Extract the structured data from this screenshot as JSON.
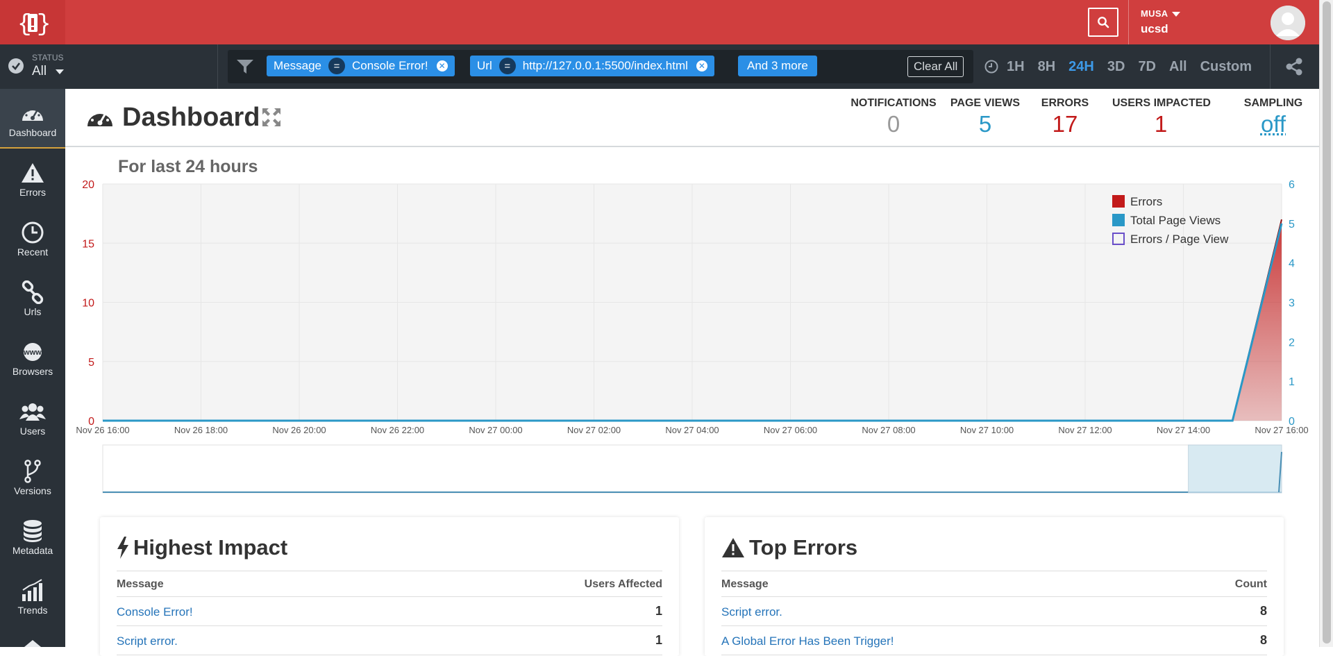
{
  "header": {
    "org_name": "MUSA",
    "user_name": "ucsd",
    "brand_color": "#d03e3e"
  },
  "filterbar": {
    "status_label": "STATUS",
    "status_value": "All",
    "chips": [
      {
        "field": "Message",
        "op": "=",
        "value": "Console Error!"
      },
      {
        "field": "Url",
        "op": "=",
        "value": "http://127.0.0.1:5500/index.html"
      }
    ],
    "more_label": "And 3 more",
    "clear_all_label": "Clear All",
    "time_options": [
      "1H",
      "8H",
      "24H",
      "3D",
      "7D",
      "All",
      "Custom"
    ],
    "active_time": "24H"
  },
  "sidebar": {
    "items": [
      {
        "label": "Dashboard",
        "icon": "dashboard-icon"
      },
      {
        "label": "Errors",
        "icon": "warning-icon"
      },
      {
        "label": "Recent",
        "icon": "clock-icon"
      },
      {
        "label": "Urls",
        "icon": "link-icon"
      },
      {
        "label": "Browsers",
        "icon": "www-icon"
      },
      {
        "label": "Users",
        "icon": "users-icon"
      },
      {
        "label": "Versions",
        "icon": "branch-icon"
      },
      {
        "label": "Metadata",
        "icon": "database-icon"
      },
      {
        "label": "Trends",
        "icon": "trends-icon"
      }
    ]
  },
  "page": {
    "title": "Dashboard",
    "stats": [
      {
        "label": "NOTIFICATIONS",
        "value": "0",
        "color": "#999999"
      },
      {
        "label": "PAGE VIEWS",
        "value": "5",
        "color": "#2a98c7"
      },
      {
        "label": "ERRORS",
        "value": "17",
        "color": "#c21a1a"
      },
      {
        "label": "USERS IMPACTED",
        "value": "1",
        "color": "#c21a1a"
      },
      {
        "label": "SAMPLING",
        "value": "off",
        "color": "#2a98c7"
      }
    ],
    "chart_heading": "For last 24 hours"
  },
  "chart_data": {
    "type": "area",
    "x": [
      "Nov 26 16:00",
      "Nov 26 18:00",
      "Nov 26 20:00",
      "Nov 26 22:00",
      "Nov 27 00:00",
      "Nov 27 02:00",
      "Nov 27 04:00",
      "Nov 27 06:00",
      "Nov 27 08:00",
      "Nov 27 10:00",
      "Nov 27 12:00",
      "Nov 27 14:00",
      "Nov 27 15:00",
      "Nov 27 16:00"
    ],
    "tick_labels": [
      "Nov 26 16:00",
      "Nov 26 18:00",
      "Nov 26 20:00",
      "Nov 26 22:00",
      "Nov 27 00:00",
      "Nov 27 02:00",
      "Nov 27 04:00",
      "Nov 27 06:00",
      "Nov 27 08:00",
      "Nov 27 10:00",
      "Nov 27 12:00",
      "Nov 27 14:00",
      "Nov 27 16:00"
    ],
    "series": [
      {
        "name": "Errors",
        "axis": "left",
        "color": "#c21a1a",
        "values": [
          0,
          0,
          0,
          0,
          0,
          0,
          0,
          0,
          0,
          0,
          0,
          0,
          0,
          17
        ]
      },
      {
        "name": "Total Page Views",
        "axis": "right",
        "color": "#2a98c7",
        "values": [
          0,
          0,
          0,
          0,
          0,
          0,
          0,
          0,
          0,
          0,
          0,
          0,
          0,
          5
        ]
      },
      {
        "name": "Errors / Page View",
        "axis": "right",
        "color": "#6a4fc9",
        "values": []
      }
    ],
    "yleft_ticks": [
      0,
      5,
      10,
      15,
      20
    ],
    "yright_ticks": [
      0,
      1,
      2,
      3,
      4,
      5,
      6
    ],
    "ylim_left": [
      0,
      20
    ],
    "ylim_right": [
      0,
      6
    ],
    "legend_position": "top-right",
    "grid": true
  },
  "highest_impact": {
    "title": "Highest Impact",
    "col_message": "Message",
    "col_value": "Users Affected",
    "rows": [
      {
        "message": "Console Error!",
        "value": "1"
      },
      {
        "message": "Script error.",
        "value": "1"
      }
    ]
  },
  "top_errors": {
    "title": "Top Errors",
    "col_message": "Message",
    "col_value": "Count",
    "rows": [
      {
        "message": "Script error.",
        "value": "8"
      },
      {
        "message": "A Global Error Has Been Trigger!",
        "value": "8"
      }
    ]
  }
}
